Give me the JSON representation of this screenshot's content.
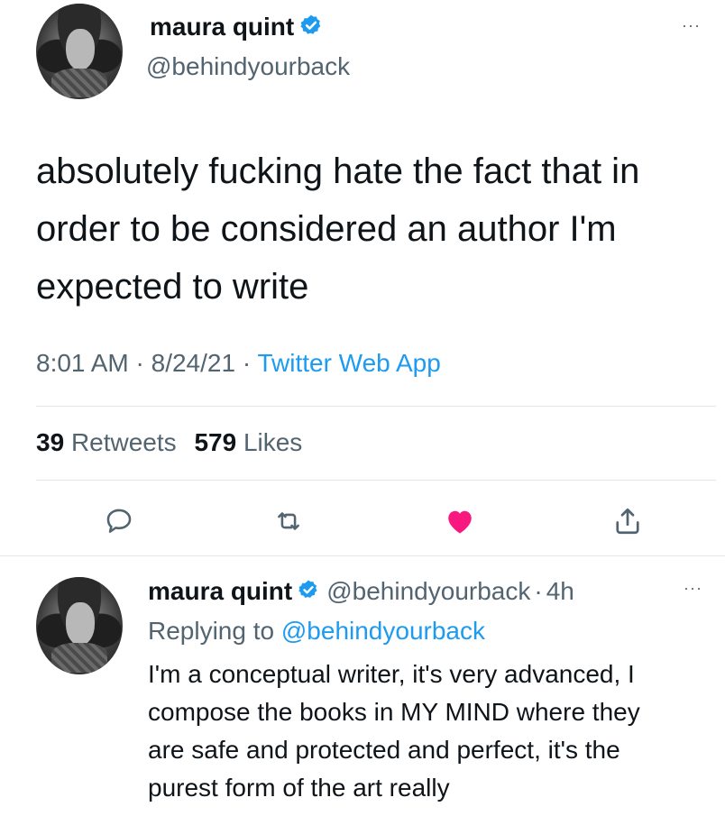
{
  "tweet": {
    "author_name": "maura quint",
    "author_handle": "@behindyourback",
    "text_lines": [
      "absolutely fucking hate the fact that in",
      "order to be considered an author I'm",
      "expected to write"
    ],
    "time": "8:01 AM",
    "date": "8/24/21",
    "separator": "·",
    "source": "Twitter Web App",
    "retweets_count": "39",
    "retweets_label": "Retweets",
    "likes_count": "579",
    "likes_label": "Likes",
    "liked": true,
    "more_label": "···"
  },
  "reply": {
    "author_name": "maura quint",
    "author_handle": "@behindyourback",
    "age": "4h",
    "separator": "·",
    "replying_prefix": "Replying to",
    "replying_to": "@behindyourback",
    "text_lines": [
      "I'm a conceptual writer, it's very advanced, I",
      "compose the books in MY MIND where they",
      "are safe and protected and perfect, it's the",
      "purest form of the art really"
    ],
    "more_label": "···"
  },
  "icons": {
    "verified": "verified-badge-icon",
    "reply": "speech-bubble-icon",
    "retweet": "retweet-arrows-icon",
    "like": "heart-icon",
    "share": "share-upload-icon"
  },
  "colors": {
    "accent": "#1d9bf0",
    "like": "#f91880",
    "secondary_text": "#536471",
    "primary_text": "#0f1419"
  }
}
